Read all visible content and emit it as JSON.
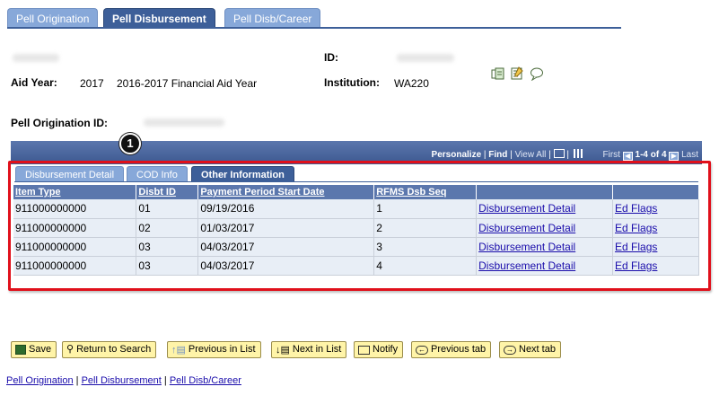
{
  "top_tabs": [
    "Pell Origination",
    "Pell Disbursement",
    "Pell Disb/Career"
  ],
  "header": {
    "id_label": "ID:",
    "aid_year_label": "Aid Year:",
    "aid_year_value": "2017",
    "aid_year_desc": "2016-2017 Financial Aid Year",
    "institution_label": "Institution:",
    "institution_value": "WA220",
    "pell_orig_label": "Pell Origination ID:"
  },
  "grid": {
    "personalize": "Personalize",
    "find": "Find",
    "view_all": "View All",
    "first": "First",
    "range": "1-4 of 4",
    "last": "Last",
    "callout": "1",
    "subtabs": [
      "Disbursement Detail",
      "COD Info",
      "Other Information"
    ],
    "columns": [
      "Item Type",
      "Disbt ID",
      "Payment Period Start Date",
      "RFMS Dsb Seq",
      "",
      ""
    ],
    "rows": [
      {
        "item_type": "911000000000",
        "disbt_id": "01",
        "start_date": "09/19/2016",
        "seq": "1",
        "detail": "Disbursement Detail",
        "flags": "Ed Flags"
      },
      {
        "item_type": "911000000000",
        "disbt_id": "02",
        "start_date": "01/03/2017",
        "seq": "2",
        "detail": "Disbursement Detail",
        "flags": "Ed Flags"
      },
      {
        "item_type": "911000000000",
        "disbt_id": "03",
        "start_date": "04/03/2017",
        "seq": "3",
        "detail": "Disbursement Detail",
        "flags": "Ed Flags"
      },
      {
        "item_type": "911000000000",
        "disbt_id": "03",
        "start_date": "04/03/2017",
        "seq": "4",
        "detail": "Disbursement Detail",
        "flags": "Ed Flags"
      }
    ]
  },
  "toolbar": {
    "save": "Save",
    "return_search": "Return to Search",
    "prev_list": "Previous in List",
    "next_list": "Next in List",
    "notify": "Notify",
    "prev_tab": "Previous tab",
    "next_tab": "Next tab"
  },
  "footer_links": [
    "Pell Origination",
    "Pell Disbursement",
    "Pell Disb/Career"
  ],
  "colors": {
    "tab_active": "#3d5f99",
    "tab_inactive": "#87a8d9",
    "highlight": "#e0101b",
    "button": "#fff4a8"
  }
}
